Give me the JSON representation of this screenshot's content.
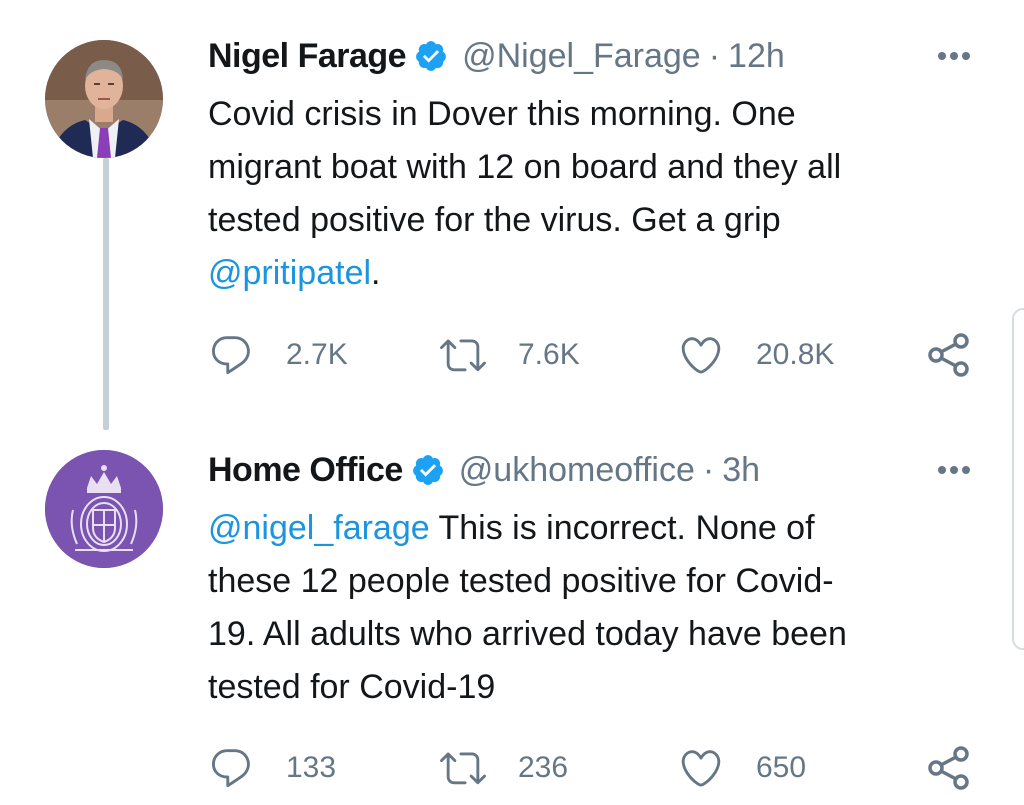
{
  "tweets": [
    {
      "name": "Nigel Farage",
      "handle": "@Nigel_Farage",
      "separator": "·",
      "time": "12h",
      "text_lines": [
        "Covid crisis in Dover this morning. One",
        "migrant boat with 12 on board and they all",
        "tested positive for the virus. Get a grip"
      ],
      "mention": "@pritipatel",
      "mention_suffix": ".",
      "replies": "2.7K",
      "retweets": "7.6K",
      "likes": "20.8K"
    },
    {
      "name": "Home Office",
      "handle": "@ukhomeoffice",
      "separator": "·",
      "time": "3h",
      "mention": "@nigel_farage",
      "text_first": " This is incorrect. None of",
      "text_lines": [
        "these 12 people tested positive for Covid-",
        "19. All adults who arrived today have been",
        "tested for Covid-19"
      ],
      "replies": "133",
      "retweets": "236",
      "likes": "650"
    }
  ],
  "colors": {
    "verified": "#1da1f2",
    "mention": "#1b95e0",
    "secondary_text": "#657786",
    "thread_line": "#c4cfd6",
    "home_office_avatar": "#7a54b0"
  },
  "icons": [
    "verified-badge-icon",
    "more-options-icon",
    "reply-icon",
    "retweet-icon",
    "like-icon",
    "share-icon",
    "crown-crest-icon"
  ]
}
